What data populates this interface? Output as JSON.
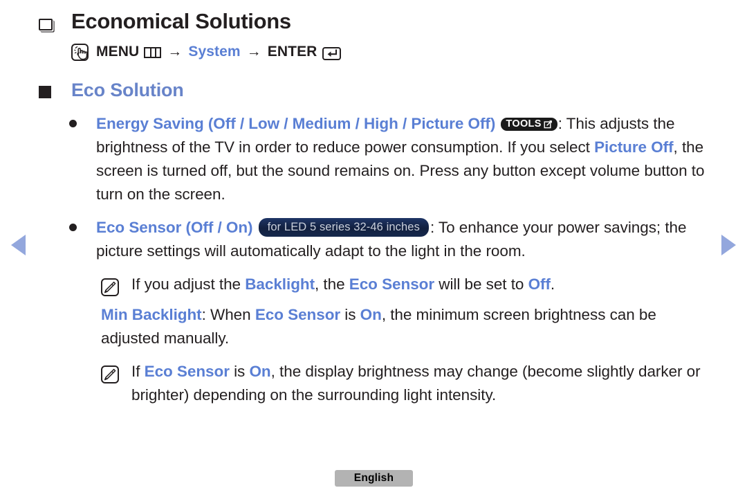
{
  "page": {
    "title": "Economical Solutions",
    "section_heading": "Eco Solution",
    "language_label": "English"
  },
  "menu_path": {
    "menu_label": "MENU",
    "arrow1": "→",
    "target": "System",
    "arrow2": "→",
    "enter_label": "ENTER",
    "touch_icon": "hand-touch-icon",
    "grid_icon": "menu-grid-icon",
    "enter_icon": "enter-key-icon"
  },
  "nav": {
    "prev_icon": "left-triangle-icon",
    "next_icon": "right-triangle-icon"
  },
  "items": [
    {
      "title": "Energy Saving (Off / Low / Medium / High / Picture Off)",
      "badge": "TOOLS",
      "badge_type": "tools",
      "text_1": ": This adjusts the brightness of the TV in order to reduce power consumption. If you select ",
      "highlight_1": "Picture Off",
      "text_2": ", the screen is turned off, but the sound remains on. Press any button except volume button to turn on the screen."
    },
    {
      "title": "Eco Sensor (Off / On)",
      "badge": "for LED 5 series 32-46 inches",
      "badge_type": "model",
      "text_1": ": To enhance your power savings; the picture settings will automatically adapt to the light in the room."
    }
  ],
  "notes": [
    {
      "icon": "note-pencil-icon",
      "t1": "If you adjust the ",
      "h1": "Backlight",
      "t2": ", the ",
      "h2": "Eco Sensor",
      "t3": " will be set to ",
      "h3": "Off",
      "t4": "."
    },
    {
      "icon": "note-pencil-icon",
      "t1": "If ",
      "h1": "Eco Sensor",
      "t2": " is ",
      "h2": "On",
      "t3": ", the display brightness may change (become slightly darker or brighter) depending on the surrounding light intensity.",
      "h3": "",
      "t4": ""
    }
  ],
  "min_backlight": {
    "label": "Min Backlight",
    "t1": ": When ",
    "h1": "Eco Sensor",
    "t2": " is ",
    "h2": "On",
    "t3": ", the minimum screen brightness can be adjusted manually."
  },
  "colors": {
    "accent_blue": "#5a7fd4",
    "heading_blue": "#6884c9",
    "arrow_blue": "#93a7dd",
    "text_dark": "#231f20",
    "badge_black": "#1a1a1a",
    "badge_navy": "#16294d",
    "chip_gray": "#b3b3b3"
  }
}
